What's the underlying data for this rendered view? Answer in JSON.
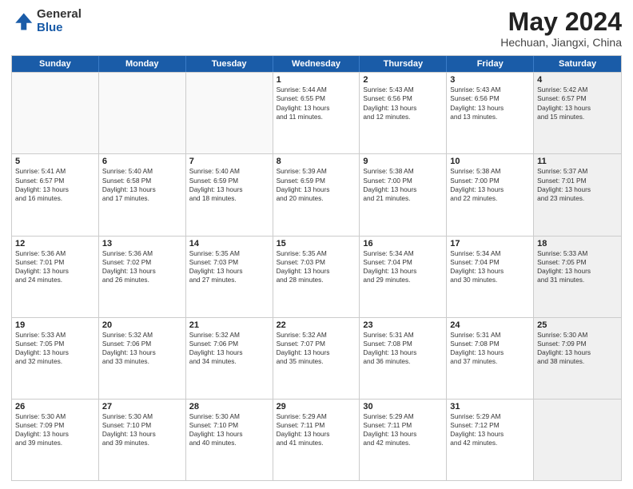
{
  "logo": {
    "general": "General",
    "blue": "Blue"
  },
  "title": "May 2024",
  "subtitle": "Hechuan, Jiangxi, China",
  "headers": [
    "Sunday",
    "Monday",
    "Tuesday",
    "Wednesday",
    "Thursday",
    "Friday",
    "Saturday"
  ],
  "weeks": [
    [
      {
        "day": "",
        "lines": [],
        "empty": true
      },
      {
        "day": "",
        "lines": [],
        "empty": true
      },
      {
        "day": "",
        "lines": [],
        "empty": true
      },
      {
        "day": "1",
        "lines": [
          "Sunrise: 5:44 AM",
          "Sunset: 6:55 PM",
          "Daylight: 13 hours",
          "and 11 minutes."
        ],
        "empty": false
      },
      {
        "day": "2",
        "lines": [
          "Sunrise: 5:43 AM",
          "Sunset: 6:56 PM",
          "Daylight: 13 hours",
          "and 12 minutes."
        ],
        "empty": false
      },
      {
        "day": "3",
        "lines": [
          "Sunrise: 5:43 AM",
          "Sunset: 6:56 PM",
          "Daylight: 13 hours",
          "and 13 minutes."
        ],
        "empty": false
      },
      {
        "day": "4",
        "lines": [
          "Sunrise: 5:42 AM",
          "Sunset: 6:57 PM",
          "Daylight: 13 hours",
          "and 15 minutes."
        ],
        "empty": false,
        "shaded": true
      }
    ],
    [
      {
        "day": "5",
        "lines": [
          "Sunrise: 5:41 AM",
          "Sunset: 6:57 PM",
          "Daylight: 13 hours",
          "and 16 minutes."
        ],
        "empty": false
      },
      {
        "day": "6",
        "lines": [
          "Sunrise: 5:40 AM",
          "Sunset: 6:58 PM",
          "Daylight: 13 hours",
          "and 17 minutes."
        ],
        "empty": false
      },
      {
        "day": "7",
        "lines": [
          "Sunrise: 5:40 AM",
          "Sunset: 6:59 PM",
          "Daylight: 13 hours",
          "and 18 minutes."
        ],
        "empty": false
      },
      {
        "day": "8",
        "lines": [
          "Sunrise: 5:39 AM",
          "Sunset: 6:59 PM",
          "Daylight: 13 hours",
          "and 20 minutes."
        ],
        "empty": false
      },
      {
        "day": "9",
        "lines": [
          "Sunrise: 5:38 AM",
          "Sunset: 7:00 PM",
          "Daylight: 13 hours",
          "and 21 minutes."
        ],
        "empty": false
      },
      {
        "day": "10",
        "lines": [
          "Sunrise: 5:38 AM",
          "Sunset: 7:00 PM",
          "Daylight: 13 hours",
          "and 22 minutes."
        ],
        "empty": false
      },
      {
        "day": "11",
        "lines": [
          "Sunrise: 5:37 AM",
          "Sunset: 7:01 PM",
          "Daylight: 13 hours",
          "and 23 minutes."
        ],
        "empty": false,
        "shaded": true
      }
    ],
    [
      {
        "day": "12",
        "lines": [
          "Sunrise: 5:36 AM",
          "Sunset: 7:01 PM",
          "Daylight: 13 hours",
          "and 24 minutes."
        ],
        "empty": false
      },
      {
        "day": "13",
        "lines": [
          "Sunrise: 5:36 AM",
          "Sunset: 7:02 PM",
          "Daylight: 13 hours",
          "and 26 minutes."
        ],
        "empty": false
      },
      {
        "day": "14",
        "lines": [
          "Sunrise: 5:35 AM",
          "Sunset: 7:03 PM",
          "Daylight: 13 hours",
          "and 27 minutes."
        ],
        "empty": false
      },
      {
        "day": "15",
        "lines": [
          "Sunrise: 5:35 AM",
          "Sunset: 7:03 PM",
          "Daylight: 13 hours",
          "and 28 minutes."
        ],
        "empty": false
      },
      {
        "day": "16",
        "lines": [
          "Sunrise: 5:34 AM",
          "Sunset: 7:04 PM",
          "Daylight: 13 hours",
          "and 29 minutes."
        ],
        "empty": false
      },
      {
        "day": "17",
        "lines": [
          "Sunrise: 5:34 AM",
          "Sunset: 7:04 PM",
          "Daylight: 13 hours",
          "and 30 minutes."
        ],
        "empty": false
      },
      {
        "day": "18",
        "lines": [
          "Sunrise: 5:33 AM",
          "Sunset: 7:05 PM",
          "Daylight: 13 hours",
          "and 31 minutes."
        ],
        "empty": false,
        "shaded": true
      }
    ],
    [
      {
        "day": "19",
        "lines": [
          "Sunrise: 5:33 AM",
          "Sunset: 7:05 PM",
          "Daylight: 13 hours",
          "and 32 minutes."
        ],
        "empty": false
      },
      {
        "day": "20",
        "lines": [
          "Sunrise: 5:32 AM",
          "Sunset: 7:06 PM",
          "Daylight: 13 hours",
          "and 33 minutes."
        ],
        "empty": false
      },
      {
        "day": "21",
        "lines": [
          "Sunrise: 5:32 AM",
          "Sunset: 7:06 PM",
          "Daylight: 13 hours",
          "and 34 minutes."
        ],
        "empty": false
      },
      {
        "day": "22",
        "lines": [
          "Sunrise: 5:32 AM",
          "Sunset: 7:07 PM",
          "Daylight: 13 hours",
          "and 35 minutes."
        ],
        "empty": false
      },
      {
        "day": "23",
        "lines": [
          "Sunrise: 5:31 AM",
          "Sunset: 7:08 PM",
          "Daylight: 13 hours",
          "and 36 minutes."
        ],
        "empty": false
      },
      {
        "day": "24",
        "lines": [
          "Sunrise: 5:31 AM",
          "Sunset: 7:08 PM",
          "Daylight: 13 hours",
          "and 37 minutes."
        ],
        "empty": false
      },
      {
        "day": "25",
        "lines": [
          "Sunrise: 5:30 AM",
          "Sunset: 7:09 PM",
          "Daylight: 13 hours",
          "and 38 minutes."
        ],
        "empty": false,
        "shaded": true
      }
    ],
    [
      {
        "day": "26",
        "lines": [
          "Sunrise: 5:30 AM",
          "Sunset: 7:09 PM",
          "Daylight: 13 hours",
          "and 39 minutes."
        ],
        "empty": false
      },
      {
        "day": "27",
        "lines": [
          "Sunrise: 5:30 AM",
          "Sunset: 7:10 PM",
          "Daylight: 13 hours",
          "and 39 minutes."
        ],
        "empty": false
      },
      {
        "day": "28",
        "lines": [
          "Sunrise: 5:30 AM",
          "Sunset: 7:10 PM",
          "Daylight: 13 hours",
          "and 40 minutes."
        ],
        "empty": false
      },
      {
        "day": "29",
        "lines": [
          "Sunrise: 5:29 AM",
          "Sunset: 7:11 PM",
          "Daylight: 13 hours",
          "and 41 minutes."
        ],
        "empty": false
      },
      {
        "day": "30",
        "lines": [
          "Sunrise: 5:29 AM",
          "Sunset: 7:11 PM",
          "Daylight: 13 hours",
          "and 42 minutes."
        ],
        "empty": false
      },
      {
        "day": "31",
        "lines": [
          "Sunrise: 5:29 AM",
          "Sunset: 7:12 PM",
          "Daylight: 13 hours",
          "and 42 minutes."
        ],
        "empty": false
      },
      {
        "day": "",
        "lines": [],
        "empty": true,
        "shaded": true
      }
    ]
  ]
}
